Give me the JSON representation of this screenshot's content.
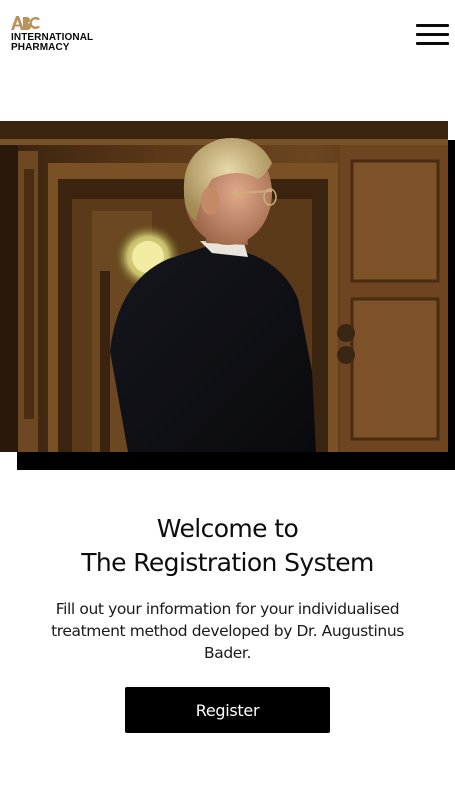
{
  "header": {
    "logo": {
      "mark_text": "ABC",
      "line1": "INTERNATIONAL",
      "line2": "PHARMACY",
      "brand_color": "#b9935a"
    },
    "menu_icon": "hamburger-menu-icon"
  },
  "hero": {
    "alt": "Man in dark suit standing in a wood-panelled hallway"
  },
  "welcome": {
    "line1": "Welcome to",
    "line2": "The Registration System"
  },
  "description": "Fill out your information for your individualised treatment method developed by Dr. Augustinus Bader.",
  "register_button": {
    "label": "Register"
  },
  "colors": {
    "primary": "#000000",
    "background": "#ffffff",
    "accent": "#b9935a"
  }
}
